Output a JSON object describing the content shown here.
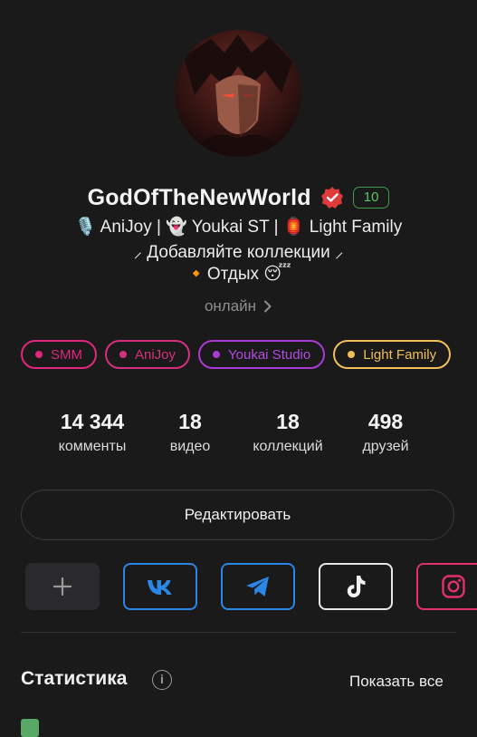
{
  "profile": {
    "username": "GodOfTheNewWorld",
    "level": "10",
    "bio_line1": "🎙️ AniJoy | 👻 Youkai ST | 🏮 Light Family",
    "bio_line2": "⸝ Добавляйте коллекции ⸝",
    "bio_line3": "🔸Отдых 😴",
    "status": "онлайн"
  },
  "tags": [
    {
      "label": "SMM",
      "color": "#e0267e"
    },
    {
      "label": "AniJoy",
      "color": "#d62f7e"
    },
    {
      "label": "Youkai Studio",
      "color": "#a93ad6"
    },
    {
      "label": "Light Family",
      "color": "#f1bf5a"
    }
  ],
  "stats": [
    {
      "value": "14 344",
      "label": "комменты"
    },
    {
      "value": "18",
      "label": "видео"
    },
    {
      "value": "18",
      "label": "коллекций"
    },
    {
      "value": "498",
      "label": "друзей"
    }
  ],
  "edit_button": "Редактировать",
  "socials": [
    {
      "icon": "plus-icon",
      "color": "#9a9a9a"
    },
    {
      "icon": "vk-icon",
      "color": "#2b86e6"
    },
    {
      "icon": "telegram-icon",
      "color": "#2b86e6"
    },
    {
      "icon": "tiktok-icon",
      "color": "#f2f2f2"
    },
    {
      "icon": "instagram-icon",
      "color": "#e0306e"
    }
  ],
  "statistics": {
    "title": "Статистика",
    "show_all": "Показать все"
  },
  "colors": {
    "background": "#1a1a1b",
    "level_badge": "#3f9a4a",
    "verified": "#e03a3a"
  }
}
